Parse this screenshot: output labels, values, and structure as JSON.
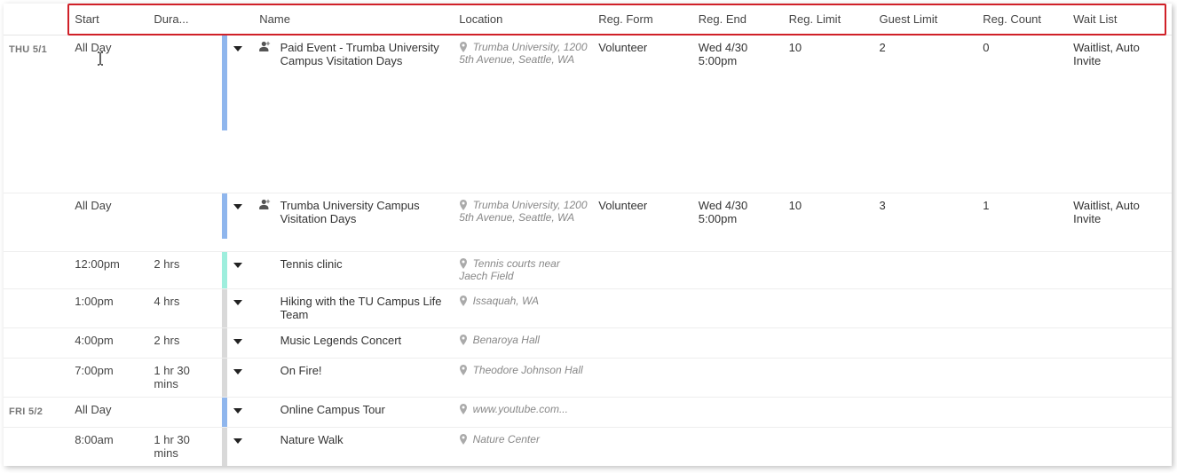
{
  "columns": {
    "start": "Start",
    "duration": "Dura...",
    "name": "Name",
    "location": "Location",
    "regform": "Reg. Form",
    "regend": "Reg. End",
    "reglimit": "Reg. Limit",
    "guestlimit": "Guest Limit",
    "regcount": "Reg. Count",
    "waitlist": "Wait List"
  },
  "days": [
    {
      "label": "THU 5/1"
    },
    {
      "label": "FRI 5/2"
    }
  ],
  "rows": [
    {
      "day_index": 0,
      "start": "All Day",
      "duration": "",
      "color": "bar-blue",
      "has_person_icon": true,
      "name": "Paid Event - Trumba University Campus Visitation Days",
      "location": "Trumba University, 1200 5th Avenue, Seattle, WA",
      "regform": "Volunteer",
      "regend": "Wed 4/30 5:00pm",
      "reglimit": "10",
      "guestlimit": "2",
      "regcount": "0",
      "waitlist": "Waitlist, Auto Invite",
      "row_class": "tall"
    },
    {
      "day_index": 0,
      "start": "All Day",
      "duration": "",
      "color": "bar-blue",
      "has_person_icon": true,
      "name": "Trumba University Campus Visitation Days",
      "location": "Trumba University, 1200 5th Avenue, Seattle, WA",
      "regform": "Volunteer",
      "regend": "Wed 4/30 5:00pm",
      "reglimit": "10",
      "guestlimit": "3",
      "regcount": "1",
      "waitlist": "Waitlist, Auto Invite",
      "row_class": "med"
    },
    {
      "day_index": 0,
      "start": "12:00pm",
      "duration": "2 hrs",
      "color": "bar-mint",
      "has_person_icon": false,
      "name": "Tennis clinic",
      "location": "Tennis courts near Jaech Field",
      "regform": "",
      "regend": "",
      "reglimit": "",
      "guestlimit": "",
      "regcount": "",
      "waitlist": "",
      "row_class": ""
    },
    {
      "day_index": 0,
      "start": "1:00pm",
      "duration": "4 hrs",
      "color": "bar-gray",
      "has_person_icon": false,
      "name": "Hiking with the TU Campus Life Team",
      "location": "Issaquah, WA",
      "regform": "",
      "regend": "",
      "reglimit": "",
      "guestlimit": "",
      "regcount": "",
      "waitlist": "",
      "row_class": ""
    },
    {
      "day_index": 0,
      "start": "4:00pm",
      "duration": "2 hrs",
      "color": "bar-gray",
      "has_person_icon": false,
      "name": "Music Legends Concert",
      "location": "Benaroya Hall",
      "regform": "",
      "regend": "",
      "reglimit": "",
      "guestlimit": "",
      "regcount": "",
      "waitlist": "",
      "row_class": ""
    },
    {
      "day_index": 0,
      "start": "7:00pm",
      "duration": "1 hr 30 mins",
      "color": "bar-gray",
      "has_person_icon": false,
      "name": "On Fire!",
      "location": "Theodore Johnson Hall",
      "regform": "",
      "regend": "",
      "reglimit": "",
      "guestlimit": "",
      "regcount": "",
      "waitlist": "",
      "row_class": ""
    },
    {
      "day_index": 1,
      "start": "All Day",
      "duration": "",
      "color": "bar-blue",
      "has_person_icon": false,
      "name": "Online Campus Tour",
      "location": "www.youtube.com...",
      "regform": "",
      "regend": "",
      "reglimit": "",
      "guestlimit": "",
      "regcount": "",
      "waitlist": "",
      "row_class": ""
    },
    {
      "day_index": 1,
      "start": "8:00am",
      "duration": "1 hr 30 mins",
      "color": "bar-gray",
      "has_person_icon": false,
      "name": "Nature Walk",
      "location": "Nature Center",
      "regform": "",
      "regend": "",
      "reglimit": "",
      "guestlimit": "",
      "regcount": "",
      "waitlist": "",
      "row_class": ""
    }
  ]
}
